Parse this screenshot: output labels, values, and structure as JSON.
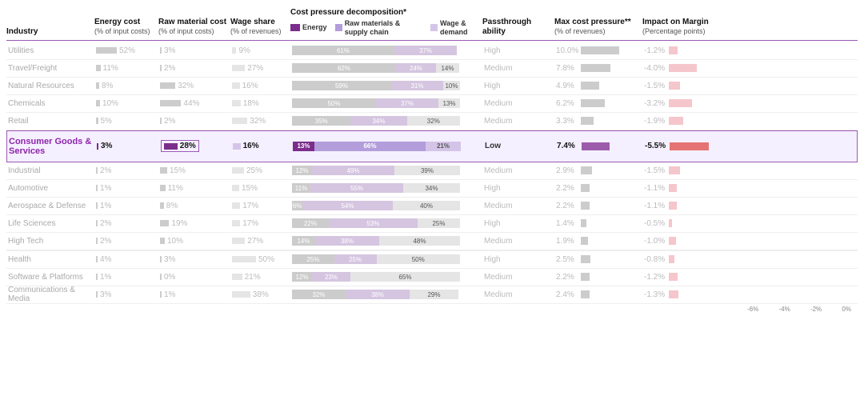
{
  "header": {
    "industry": "Industry",
    "energy_cost": "Energy cost",
    "energy_sub": "(% of input costs)",
    "raw_cost": "Raw material cost",
    "raw_sub": "(% of input costs)",
    "wage": "Wage share",
    "wage_sub": "(% of revenues)",
    "pressure": "Cost pressure decomposition*",
    "passthrough": "Passthrough ability",
    "maxcost": "Max cost pressure**",
    "maxcost_sub": "(% of revenues)",
    "impact": "Impact on Margin",
    "impact_sub": "(Percentage points)"
  },
  "legend": {
    "energy": "Energy",
    "raw": "Raw materials & supply chain",
    "wage": "Wage & demand"
  },
  "rows": [
    {
      "name": "Utilities",
      "dimmed": true,
      "highlighted": false,
      "energy": "52%",
      "energy_w": 52,
      "raw": "3%",
      "raw_w": 3,
      "wage": "9%",
      "wage_w": 9,
      "p1": 61,
      "p1l": "61%",
      "p2": 37,
      "p2l": "37%",
      "p3": 0,
      "p3l": "",
      "passthrough": "High",
      "maxcost": "10.0%",
      "mc_w": 80,
      "impact": "-1.2%",
      "imp_w": 16
    },
    {
      "name": "Travel/Freight",
      "dimmed": true,
      "highlighted": false,
      "energy": "11%",
      "energy_w": 11,
      "raw": "2%",
      "raw_w": 2,
      "wage": "27%",
      "wage_w": 27,
      "p1": 62,
      "p1l": "62%",
      "p2": 24,
      "p2l": "24%",
      "p3": 14,
      "p3l": "14%",
      "passthrough": "Medium",
      "maxcost": "7.8%",
      "mc_w": 62,
      "impact": "-4.0%",
      "imp_w": 50
    },
    {
      "name": "Natural Resources",
      "dimmed": true,
      "highlighted": false,
      "energy": "8%",
      "energy_w": 8,
      "raw": "32%",
      "raw_w": 32,
      "wage": "16%",
      "wage_w": 16,
      "p1": 59,
      "p1l": "59%",
      "p2": 31,
      "p2l": "31%",
      "p3": 10,
      "p3l": "10%",
      "passthrough": "High",
      "maxcost": "4.9%",
      "mc_w": 39,
      "impact": "-1.5%",
      "imp_w": 20
    },
    {
      "name": "Chemicals",
      "dimmed": true,
      "highlighted": false,
      "energy": "10%",
      "energy_w": 10,
      "raw": "44%",
      "raw_w": 44,
      "wage": "18%",
      "wage_w": 18,
      "p1": 50,
      "p1l": "50%",
      "p2": 37,
      "p2l": "37%",
      "p3": 13,
      "p3l": "13%",
      "passthrough": "Medium",
      "maxcost": "6.2%",
      "mc_w": 50,
      "impact": "-3.2%",
      "imp_w": 42
    },
    {
      "name": "Retail",
      "dimmed": true,
      "highlighted": false,
      "energy": "5%",
      "energy_w": 5,
      "raw": "2%",
      "raw_w": 2,
      "wage": "32%",
      "wage_w": 32,
      "p1": 35,
      "p1l": "35%",
      "p2": 34,
      "p2l": "34%",
      "p3": 32,
      "p3l": "32%",
      "passthrough": "Medium",
      "maxcost": "3.3%",
      "mc_w": 26,
      "impact": "-1.9%",
      "imp_w": 25
    },
    {
      "name": "Consumer Goods & Services",
      "dimmed": false,
      "highlighted": true,
      "energy": "3%",
      "energy_w": 3,
      "raw": "28%",
      "raw_w": 28,
      "wage": "16%",
      "wage_w": 16,
      "p1": 13,
      "p1l": "13%",
      "p2": 66,
      "p2l": "66%",
      "p3": 21,
      "p3l": "21%",
      "passthrough": "Low",
      "maxcost": "7.4%",
      "mc_w": 59,
      "impact": "-5.5%",
      "imp_w": 70
    },
    {
      "name": "Industrial",
      "dimmed": true,
      "highlighted": false,
      "energy": "2%",
      "energy_w": 2,
      "raw": "15%",
      "raw_w": 15,
      "wage": "25%",
      "wage_w": 25,
      "p1": 12,
      "p1l": "12%",
      "p2": 49,
      "p2l": "49%",
      "p3": 39,
      "p3l": "39%",
      "passthrough": "Medium",
      "maxcost": "2.9%",
      "mc_w": 23,
      "impact": "-1.5%",
      "imp_w": 20
    },
    {
      "name": "Automotive",
      "dimmed": true,
      "highlighted": false,
      "energy": "1%",
      "energy_w": 1,
      "raw": "11%",
      "raw_w": 11,
      "wage": "15%",
      "wage_w": 15,
      "p1": 11,
      "p1l": "11%",
      "p2": 55,
      "p2l": "55%",
      "p3": 34,
      "p3l": "34%",
      "passthrough": "High",
      "maxcost": "2.2%",
      "mc_w": 18,
      "impact": "-1.1%",
      "imp_w": 14
    },
    {
      "name": "Aerospace & Defense",
      "dimmed": true,
      "highlighted": false,
      "energy": "1%",
      "energy_w": 1,
      "raw": "8%",
      "raw_w": 8,
      "wage": "17%",
      "wage_w": 17,
      "p1": 6,
      "p1l": "6%",
      "p2": 54,
      "p2l": "54%",
      "p3": 40,
      "p3l": "40%",
      "passthrough": "Medium",
      "maxcost": "2.2%",
      "mc_w": 18,
      "impact": "-1.1%",
      "imp_w": 14
    },
    {
      "name": "Life Sciences",
      "dimmed": true,
      "highlighted": false,
      "energy": "2%",
      "energy_w": 2,
      "raw": "19%",
      "raw_w": 19,
      "wage": "17%",
      "wage_w": 17,
      "p1": 22,
      "p1l": "22%",
      "p2": 53,
      "p2l": "53%",
      "p3": 25,
      "p3l": "25%",
      "passthrough": "High",
      "maxcost": "1.4%",
      "mc_w": 11,
      "impact": "-0.5%",
      "imp_w": 6
    },
    {
      "name": "High Tech",
      "dimmed": true,
      "highlighted": false,
      "energy": "2%",
      "energy_w": 2,
      "raw": "10%",
      "raw_w": 10,
      "wage": "27%",
      "wage_w": 27,
      "p1": 14,
      "p1l": "14%",
      "p2": 38,
      "p2l": "38%",
      "p3": 48,
      "p3l": "48%",
      "passthrough": "Medium",
      "maxcost": "1.9%",
      "mc_w": 15,
      "impact": "-1.0%",
      "imp_w": 13
    },
    {
      "name": "Health",
      "dimmed": true,
      "highlighted": false,
      "energy": "4%",
      "energy_w": 4,
      "raw": "3%",
      "raw_w": 3,
      "wage": "50%",
      "wage_w": 50,
      "p1": 25,
      "p1l": "25%",
      "p2": 25,
      "p2l": "25%",
      "p3": 50,
      "p3l": "50%",
      "passthrough": "High",
      "maxcost": "2.5%",
      "mc_w": 20,
      "impact": "-0.8%",
      "imp_w": 10
    },
    {
      "name": "Software & Platforms",
      "dimmed": true,
      "highlighted": false,
      "energy": "1%",
      "energy_w": 1,
      "raw": "0%",
      "raw_w": 0,
      "wage": "21%",
      "wage_w": 21,
      "p1": 12,
      "p1l": "12%",
      "p2": 23,
      "p2l": "23%",
      "p3": 65,
      "p3l": "65%",
      "passthrough": "Medium",
      "maxcost": "2.2%",
      "mc_w": 18,
      "impact": "-1.2%",
      "imp_w": 16
    },
    {
      "name": "Communications & Media",
      "dimmed": true,
      "highlighted": false,
      "energy": "3%",
      "energy_w": 3,
      "raw": "1%",
      "raw_w": 1,
      "wage": "38%",
      "wage_w": 38,
      "p1": 32,
      "p1l": "32%",
      "p2": 38,
      "p2l": "38%",
      "p3": 29,
      "p3l": "29%",
      "passthrough": "Medium",
      "maxcost": "2.4%",
      "mc_w": 19,
      "impact": "-1.3%",
      "imp_w": 17
    }
  ],
  "xaxis": {
    "labels": [
      "-6%",
      "-4%",
      "-2%",
      "0%"
    ]
  }
}
